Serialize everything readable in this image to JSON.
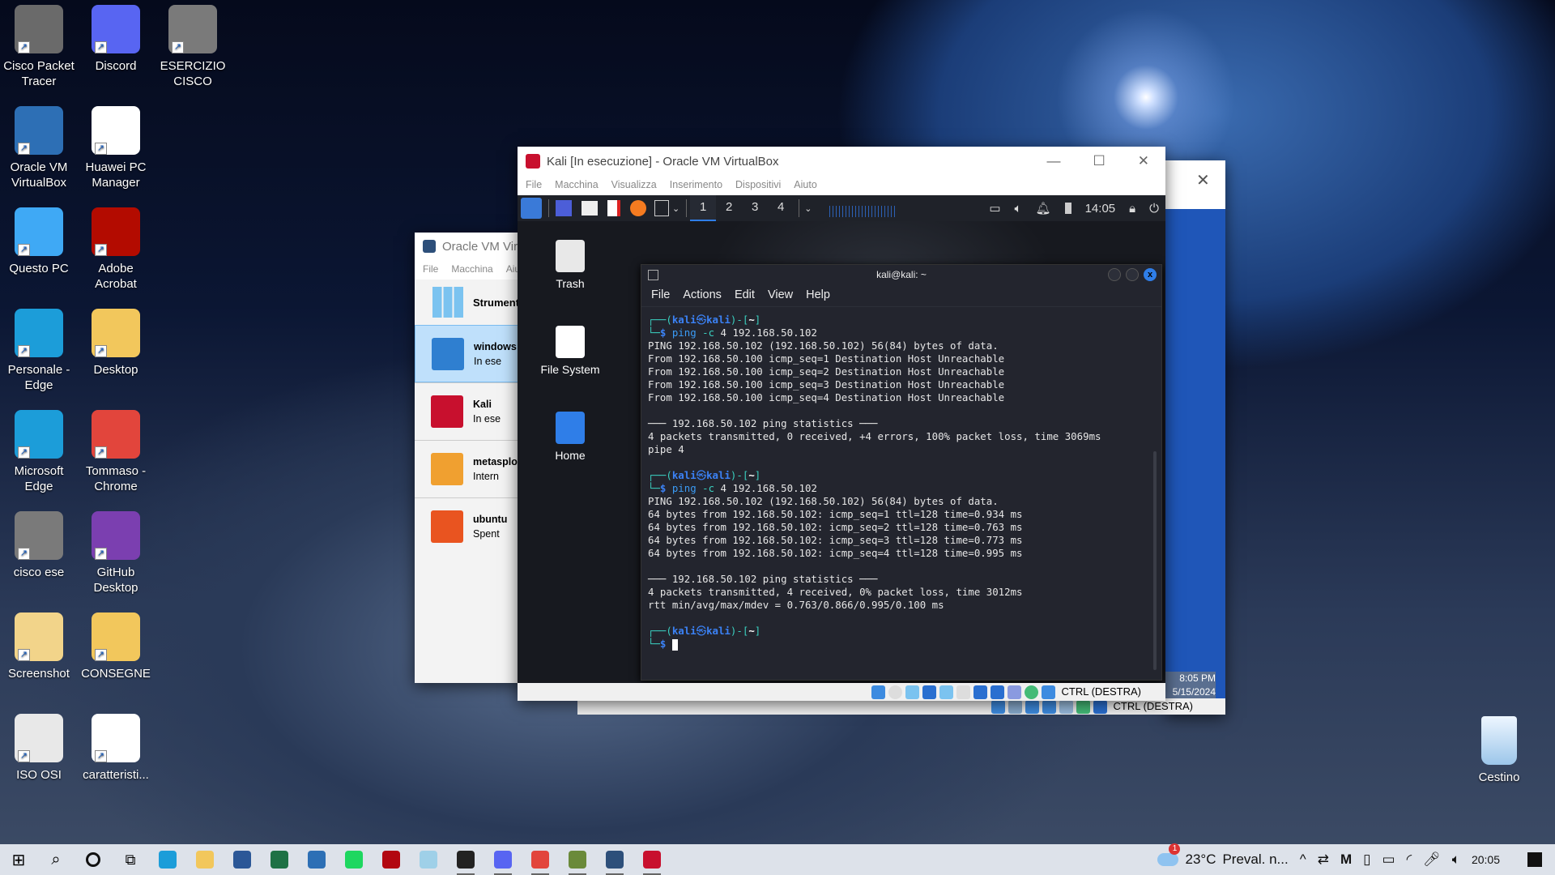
{
  "desktop": {
    "icons": [
      {
        "label": "Cisco Packet Tracer",
        "color": "#6a6a6a"
      },
      {
        "label": "Discord",
        "color": "#5865f2"
      },
      {
        "label": "ESERCIZIO CISCO",
        "color": "#7a7a7a"
      },
      {
        "label": "Oracle VM VirtualBox",
        "color": "#2d6fb5"
      },
      {
        "label": "Huawei PC Manager",
        "color": "#ffffff"
      },
      {
        "label": "Questo PC",
        "color": "#3fa9f5"
      },
      {
        "label": "Adobe Acrobat",
        "color": "#b30b00"
      },
      {
        "label": "Personale - Edge",
        "color": "#1c9dd9"
      },
      {
        "label": "Desktop",
        "color": "#f2c75c"
      },
      {
        "label": "Microsoft Edge",
        "color": "#1c9dd9"
      },
      {
        "label": "Tommaso - Chrome",
        "color": "#e2453c"
      },
      {
        "label": "cisco ese",
        "color": "#7a7a7a"
      },
      {
        "label": "GitHub Desktop",
        "color": "#7b3fb0"
      },
      {
        "label": "Screenshot",
        "color": "#f2d48a"
      },
      {
        "label": "CONSEGNE",
        "color": "#f2c75c"
      },
      {
        "label": "ISO OSI",
        "color": "#e8e8e8"
      },
      {
        "label": "caratteristi...",
        "color": "#ffffff"
      }
    ],
    "recycle_bin": "Cestino"
  },
  "vbox_manager": {
    "title": "Oracle VM Vir",
    "menu": [
      "File",
      "Macchina",
      "Aiu"
    ],
    "tools": "Strument",
    "vms": [
      {
        "name": "windows",
        "state": "In ese",
        "selected": true,
        "color": "#2f7fd0"
      },
      {
        "name": "Kali",
        "state": "In ese",
        "color": "#c8102e"
      },
      {
        "name": "metasplo",
        "state": "Intern",
        "color": "#f0a030"
      },
      {
        "name": "ubuntu",
        "state": "Spent",
        "color": "#e95420"
      }
    ]
  },
  "back_vm": {
    "time": "8:05 PM",
    "date": "5/15/2024",
    "host_key": "CTRL (DESTRA)"
  },
  "kali_vm": {
    "title": "Kali [In esecuzione] - Oracle VM VirtualBox",
    "menu": [
      "File",
      "Macchina",
      "Visualizza",
      "Inserimento",
      "Dispositivi",
      "Aiuto"
    ],
    "workspaces": [
      "1",
      "2",
      "3",
      "4"
    ],
    "active_workspace": "1",
    "clock": "14:05",
    "host_key": "CTRL (DESTRA)",
    "desktop_icons": [
      "Trash",
      "File System",
      "Home"
    ]
  },
  "terminal": {
    "title": "kali@kali: ~",
    "menu": [
      "File",
      "Actions",
      "Edit",
      "View",
      "Help"
    ],
    "lines": [
      {
        "t": "prompt",
        "user": "kali",
        "host": "kali",
        "dir": "~"
      },
      {
        "t": "cmd",
        "cmd": "ping",
        "args": "-c",
        "rest": "4 192.168.50.102"
      },
      {
        "t": "out",
        "text": "PING 192.168.50.102 (192.168.50.102) 56(84) bytes of data."
      },
      {
        "t": "out",
        "text": "From 192.168.50.100 icmp_seq=1 Destination Host Unreachable"
      },
      {
        "t": "out",
        "text": "From 192.168.50.100 icmp_seq=2 Destination Host Unreachable"
      },
      {
        "t": "out",
        "text": "From 192.168.50.100 icmp_seq=3 Destination Host Unreachable"
      },
      {
        "t": "out",
        "text": "From 192.168.50.100 icmp_seq=4 Destination Host Unreachable"
      },
      {
        "t": "out",
        "text": ""
      },
      {
        "t": "out",
        "text": "─── 192.168.50.102 ping statistics ───"
      },
      {
        "t": "out",
        "text": "4 packets transmitted, 0 received, +4 errors, 100% packet loss, time 3069ms"
      },
      {
        "t": "out",
        "text": "pipe 4"
      },
      {
        "t": "out",
        "text": ""
      },
      {
        "t": "prompt",
        "user": "kali",
        "host": "kali",
        "dir": "~"
      },
      {
        "t": "cmd",
        "cmd": "ping",
        "args": "-c",
        "rest": "4 192.168.50.102"
      },
      {
        "t": "out",
        "text": "PING 192.168.50.102 (192.168.50.102) 56(84) bytes of data."
      },
      {
        "t": "out",
        "text": "64 bytes from 192.168.50.102: icmp_seq=1 ttl=128 time=0.934 ms"
      },
      {
        "t": "out",
        "text": "64 bytes from 192.168.50.102: icmp_seq=2 ttl=128 time=0.763 ms"
      },
      {
        "t": "out",
        "text": "64 bytes from 192.168.50.102: icmp_seq=3 ttl=128 time=0.773 ms"
      },
      {
        "t": "out",
        "text": "64 bytes from 192.168.50.102: icmp_seq=4 ttl=128 time=0.995 ms"
      },
      {
        "t": "out",
        "text": ""
      },
      {
        "t": "out",
        "text": "─── 192.168.50.102 ping statistics ───"
      },
      {
        "t": "out",
        "text": "4 packets transmitted, 4 received, 0% packet loss, time 3012ms"
      },
      {
        "t": "out",
        "text": "rtt min/avg/max/mdev = 0.763/0.866/0.995/0.100 ms"
      },
      {
        "t": "out",
        "text": ""
      },
      {
        "t": "prompt",
        "user": "kali",
        "host": "kali",
        "dir": "~"
      },
      {
        "t": "cursor"
      }
    ]
  },
  "taskbar": {
    "apps": [
      {
        "name": "edge",
        "color": "#1c9dd9"
      },
      {
        "name": "file-explorer",
        "color": "#f2c75c"
      },
      {
        "name": "word",
        "color": "#2b5797"
      },
      {
        "name": "excel",
        "color": "#1e7145"
      },
      {
        "name": "store",
        "color": "#2d6fb5"
      },
      {
        "name": "spotify",
        "color": "#1ed760"
      },
      {
        "name": "netflix",
        "color": "#b20710"
      },
      {
        "name": "notepad",
        "color": "#9fd0e8"
      },
      {
        "name": "webex",
        "color": "#222"
      },
      {
        "name": "discord",
        "color": "#5865f2"
      },
      {
        "name": "chrome",
        "color": "#e2453c"
      },
      {
        "name": "packet-tracer",
        "color": "#6a8a3a"
      },
      {
        "name": "virtualbox",
        "color": "#2d4f7a"
      },
      {
        "name": "kali-vm",
        "color": "#c8102e"
      }
    ],
    "weather_badge": "1",
    "temperature": "23°C",
    "weather": "Preval. n...",
    "clock": "20:05"
  }
}
